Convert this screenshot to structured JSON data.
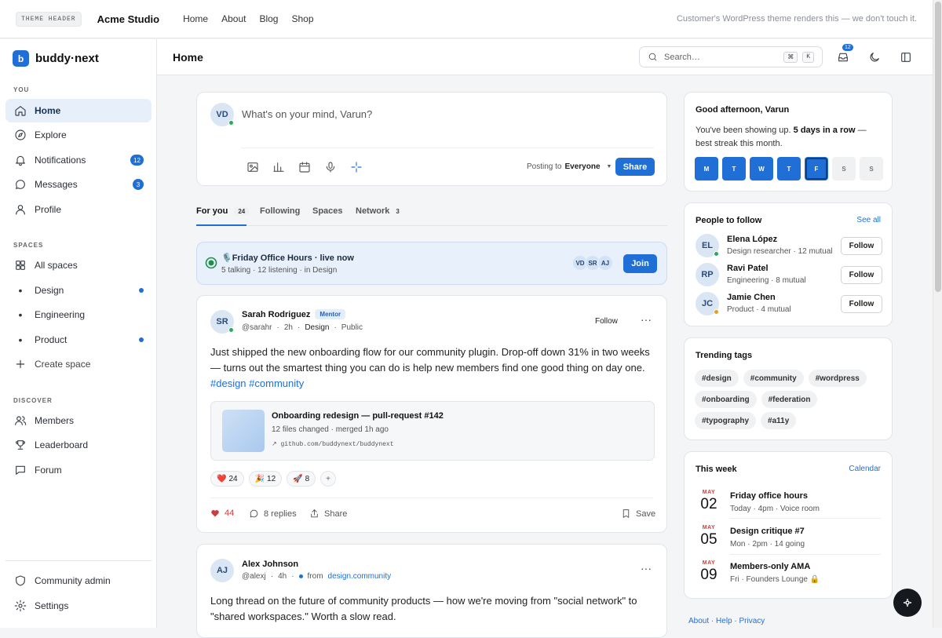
{
  "theme_header": {
    "tag": "THEME HEADER",
    "site_name": "Acme Studio",
    "nav": [
      "Home",
      "About",
      "Blog",
      "Shop"
    ],
    "note": "Customer's WordPress theme renders this — we don't touch it."
  },
  "app": {
    "logo_letter": "b",
    "name": "buddy·next"
  },
  "sidebar": {
    "you_label": "YOU",
    "you_items": [
      {
        "label": "Home",
        "icon": "home-icon"
      },
      {
        "label": "Explore",
        "icon": "compass-icon"
      },
      {
        "label": "Notifications",
        "icon": "bell-icon",
        "badge": "12"
      },
      {
        "label": "Messages",
        "icon": "message-icon",
        "badge": "3"
      },
      {
        "label": "Profile",
        "icon": "user-icon"
      }
    ],
    "spaces_label": "SPACES",
    "spaces_items": [
      {
        "label": "All spaces",
        "icon": "grid-icon"
      },
      {
        "label": "Design",
        "icon": "bullet",
        "new": true
      },
      {
        "label": "Engineering",
        "icon": "bullet"
      },
      {
        "label": "Product",
        "icon": "bullet",
        "new": true
      },
      {
        "label": "Create space",
        "icon": "plus-icon"
      }
    ],
    "discover_label": "DISCOVER",
    "discover_items": [
      {
        "label": "Members",
        "icon": "users-icon"
      },
      {
        "label": "Leaderboard",
        "icon": "trophy-icon"
      },
      {
        "label": "Forum",
        "icon": "message-icon"
      }
    ],
    "bottom_items": [
      {
        "label": "Community admin",
        "icon": "shield-icon"
      },
      {
        "label": "Settings",
        "icon": "gear-icon"
      }
    ]
  },
  "topbar": {
    "title": "Home",
    "search_placeholder": "Search…",
    "kbd": [
      "⌘",
      "K"
    ],
    "notif_badge": "12"
  },
  "composer": {
    "avatar": "VD",
    "placeholder": "What's on your mind, Varun?",
    "posting_to_label": "Posting to",
    "audience": "Everyone",
    "share_label": "Share"
  },
  "tabs": [
    {
      "label": "For you",
      "count": "24"
    },
    {
      "label": "Following"
    },
    {
      "label": "Spaces"
    },
    {
      "label": "Network",
      "count": "3"
    }
  ],
  "live": {
    "title": "🎙️Friday Office Hours · live now",
    "sub": "5 talking · 12 listening · in Design",
    "avatars": [
      "VD",
      "SR",
      "AJ"
    ],
    "join_label": "Join"
  },
  "post1": {
    "avatar": "SR",
    "name": "Sarah Rodriguez",
    "badge": "Mentor",
    "handle": "@sarahr",
    "time": "2h",
    "space": "Design",
    "visibility": "Public",
    "follow_label": "Follow",
    "body": "Just shipped the new onboarding flow for our community plugin. Drop-off down 31% in two weeks — turns out the smartest thing you can do is help new members find one good thing on day one.",
    "tags": "#design #community",
    "link": {
      "title": "Onboarding redesign — pull-request #142",
      "sub": "12 files changed · merged 1h ago",
      "url": "↗ github.com/buddynext/buddynext"
    },
    "reactions": [
      {
        "emoji": "❤️",
        "count": "24"
      },
      {
        "emoji": "🎉",
        "count": "12"
      },
      {
        "emoji": "🚀",
        "count": "8"
      }
    ],
    "reaction_add": "+",
    "likes": "44",
    "replies": "8 replies",
    "share": "Share",
    "save": "Save"
  },
  "post2": {
    "avatar": "AJ",
    "name": "Alex Johnson",
    "handle": "@alexj",
    "time": "4h",
    "from_label": "from",
    "source": "design.community",
    "body": "Long thread on the future of community products — how we're moving from \"social network\" to \"shared workspaces.\" Worth a slow read."
  },
  "streak": {
    "greeting": "Good afternoon, Varun",
    "text_pre": "You've been showing up.",
    "text_bold": "5 days in a row",
    "text_post": "— best streak this month.",
    "days": [
      {
        "label": "M",
        "done": true
      },
      {
        "label": "T",
        "done": true
      },
      {
        "label": "W",
        "done": true
      },
      {
        "label": "T",
        "done": true
      },
      {
        "label": "F",
        "done": true,
        "today": true
      },
      {
        "label": "S",
        "done": false
      },
      {
        "label": "S",
        "done": false
      }
    ]
  },
  "people": {
    "title": "People to follow",
    "see_all": "See all",
    "follow_label": "Follow",
    "items": [
      {
        "avatar": "EL",
        "name": "Elena López",
        "sub": "Design researcher · 12 mutual",
        "online": true
      },
      {
        "avatar": "RP",
        "name": "Ravi Patel",
        "sub": "Engineering · 8 mutual",
        "online": false
      },
      {
        "avatar": "JC",
        "name": "Jamie Chen",
        "sub": "Product · 4 mutual",
        "online": true
      }
    ]
  },
  "trending": {
    "title": "Trending tags",
    "tags": [
      "#design",
      "#community",
      "#wordpress",
      "#onboarding",
      "#federation",
      "#typography",
      "#a11y"
    ]
  },
  "week": {
    "title": "This week",
    "calendar": "Calendar",
    "events": [
      {
        "month": "MAY",
        "day": "02",
        "title": "Friday office hours",
        "sub": "Today · 4pm · Voice room"
      },
      {
        "month": "MAY",
        "day": "05",
        "title": "Design critique #7",
        "sub": "Mon · 2pm · 14 going"
      },
      {
        "month": "MAY",
        "day": "09",
        "title": "Members-only AMA",
        "sub": "Fri · Founders Lounge 🔒"
      }
    ]
  },
  "footer": {
    "links": [
      "About",
      "Help",
      "Privacy"
    ]
  },
  "colors": {
    "accent": "#1f6fd6",
    "online": "#2fa85a",
    "live_bg": "#e8f0fb"
  }
}
